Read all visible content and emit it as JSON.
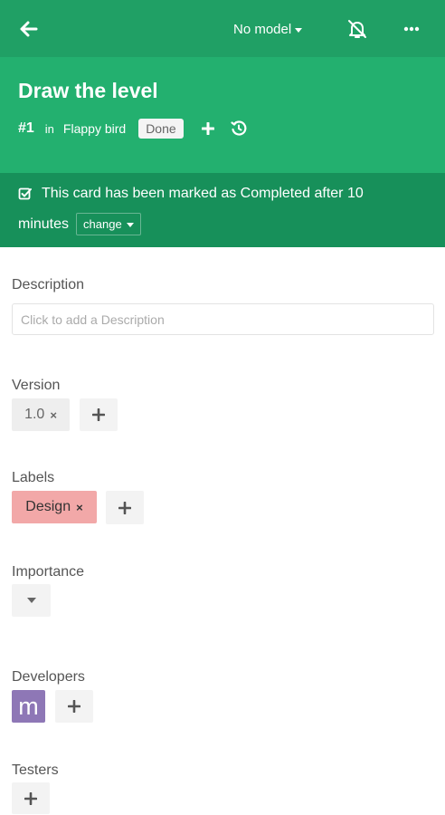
{
  "topbar": {
    "back_icon": "arrow-left-icon",
    "model_label": "No model",
    "bell_icon": "bell-off-icon",
    "more_icon": "more-horizontal-icon"
  },
  "card": {
    "title": "Draw the level",
    "number": "#1",
    "in_label": "in",
    "project": "Flappy bird",
    "status": "Done"
  },
  "notice": {
    "line1": "This card has been marked as Completed after 10",
    "line2": "minutes",
    "change_label": "change"
  },
  "description": {
    "label": "Description",
    "placeholder": "Click to add a Description",
    "value": ""
  },
  "version": {
    "label": "Version",
    "value": "1.0"
  },
  "labels": {
    "label": "Labels",
    "items": [
      {
        "name": "Design",
        "color": "#f2a8a8"
      }
    ]
  },
  "importance": {
    "label": "Importance"
  },
  "developers": {
    "label": "Developers",
    "avatar_letter": "m"
  },
  "testers": {
    "label": "Testers"
  },
  "colors": {
    "topbar": "#20a065",
    "header": "#23b06f",
    "notice": "#17905a",
    "avatar": "#8e77b6"
  }
}
